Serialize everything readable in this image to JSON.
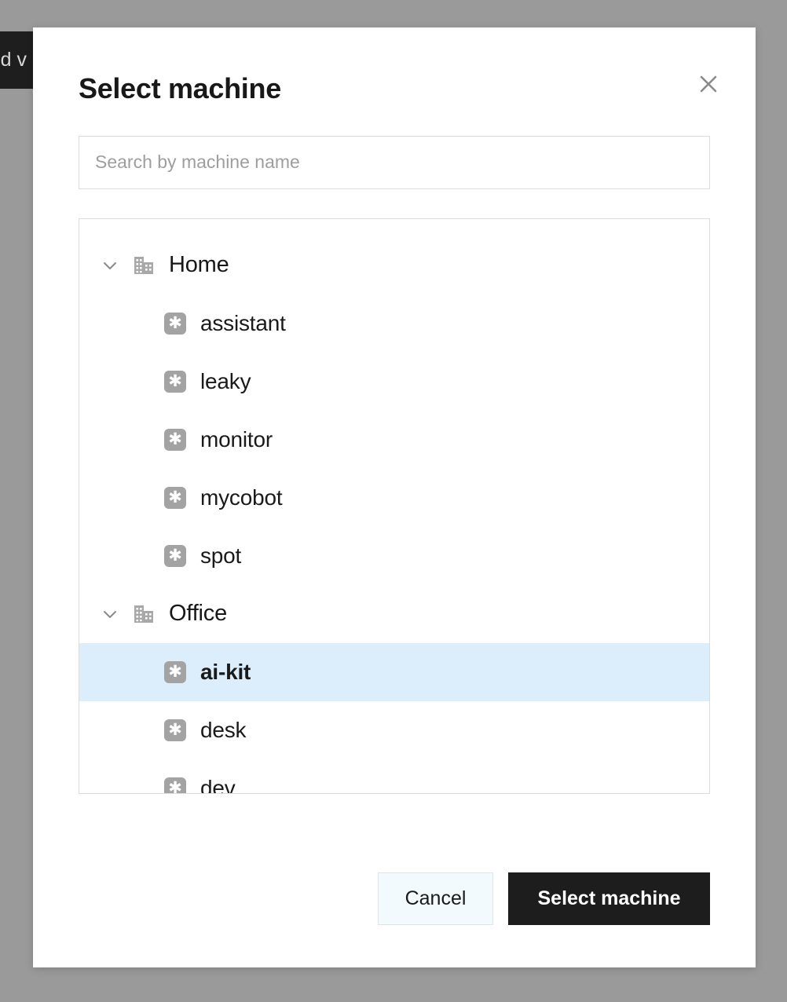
{
  "background": {
    "overlay_color": "#9a9a9a",
    "hidden_button_label": "dd v"
  },
  "modal": {
    "title": "Select machine",
    "close_icon": "close-icon",
    "search": {
      "placeholder": "Search by machine name",
      "value": ""
    },
    "tree": {
      "groups": [
        {
          "name": "Home",
          "icon": "building-icon",
          "expanded": true,
          "chevron": "chevron-down-icon",
          "machines": [
            {
              "name": "assistant",
              "icon": "machine-icon",
              "selected": false
            },
            {
              "name": "leaky",
              "icon": "machine-icon",
              "selected": false
            },
            {
              "name": "monitor",
              "icon": "machine-icon",
              "selected": false
            },
            {
              "name": "mycobot",
              "icon": "machine-icon",
              "selected": false
            },
            {
              "name": "spot",
              "icon": "machine-icon",
              "selected": false
            }
          ]
        },
        {
          "name": "Office",
          "icon": "building-icon",
          "expanded": true,
          "chevron": "chevron-down-icon",
          "machines": [
            {
              "name": "ai-kit",
              "icon": "machine-icon",
              "selected": true
            },
            {
              "name": "desk",
              "icon": "machine-icon",
              "selected": false
            },
            {
              "name": "dev",
              "icon": "machine-icon",
              "selected": false
            }
          ]
        }
      ]
    },
    "footer": {
      "cancel_label": "Cancel",
      "confirm_label": "Select machine"
    }
  },
  "colors": {
    "selected_row": "#dcedfc",
    "primary_button": "#1d1d1d",
    "cancel_button": "#f3fafd",
    "border": "#dcdcdc",
    "icon_gray": "#a3a3a3"
  }
}
